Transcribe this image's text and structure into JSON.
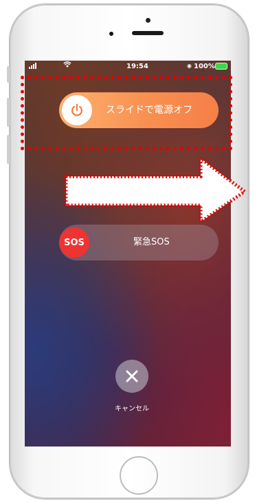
{
  "status_bar": {
    "time": "19:54",
    "battery": "100%"
  },
  "power_slider": {
    "label": "スライドで電源オフ"
  },
  "sos_slider": {
    "knob_label": "SOS",
    "label": "緊急SOS"
  },
  "cancel": {
    "label": "キャンセル"
  },
  "colors": {
    "power_slider": "#f89050",
    "sos_knob": "#ee3333",
    "annotation": "#e60000",
    "battery": "#3dd64f"
  },
  "icons": {
    "power_knob": "power-icon",
    "cancel": "close-icon",
    "status": [
      "signal-icon",
      "wifi-icon",
      "lock-icon",
      "battery-icon"
    ]
  }
}
